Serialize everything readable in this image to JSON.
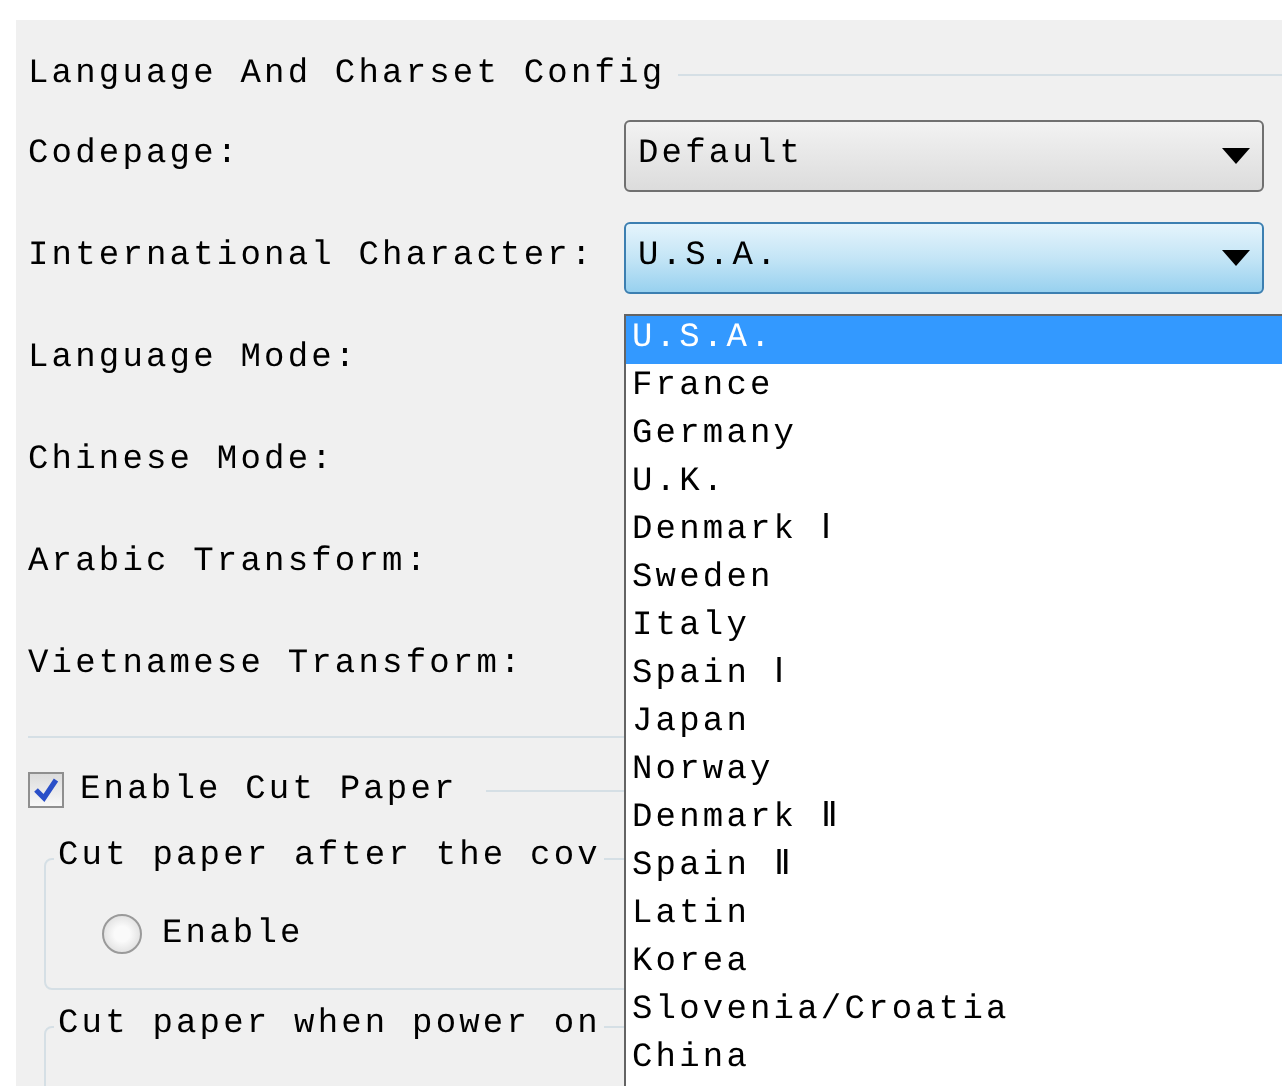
{
  "group": {
    "title": "Language And Charset Config"
  },
  "fields": [
    {
      "label": "Codepage:",
      "value": "Default",
      "focused": false
    },
    {
      "label": "International Character:",
      "value": "U.S.A.",
      "focused": true
    },
    {
      "label": "Language Mode:"
    },
    {
      "label": "Chinese Mode:"
    },
    {
      "label": "Arabic Transform:"
    },
    {
      "label": "Vietnamese Transform:"
    }
  ],
  "dropdown": {
    "items": [
      {
        "label": "U.S.A.",
        "selected": true
      },
      {
        "label": "France",
        "selected": false
      },
      {
        "label": "Germany",
        "selected": false
      },
      {
        "label": "U.K.",
        "selected": false
      },
      {
        "label": "Denmark Ⅰ",
        "selected": false
      },
      {
        "label": "Sweden",
        "selected": false
      },
      {
        "label": "Italy",
        "selected": false
      },
      {
        "label": "Spain Ⅰ",
        "selected": false
      },
      {
        "label": "Japan",
        "selected": false
      },
      {
        "label": "Norway",
        "selected": false
      },
      {
        "label": "Denmark Ⅱ",
        "selected": false
      },
      {
        "label": "Spain Ⅱ",
        "selected": false
      },
      {
        "label": "Latin",
        "selected": false
      },
      {
        "label": "Korea",
        "selected": false
      },
      {
        "label": "Slovenia/Croatia",
        "selected": false
      },
      {
        "label": "China",
        "selected": false
      }
    ]
  },
  "cut_paper": {
    "label": "Enable Cut Paper",
    "checked": true,
    "sections": [
      {
        "title": "Cut paper after the cov",
        "options": [
          {
            "label": "Enable",
            "selected": false
          }
        ]
      },
      {
        "title": "Cut paper when power on"
      }
    ]
  }
}
